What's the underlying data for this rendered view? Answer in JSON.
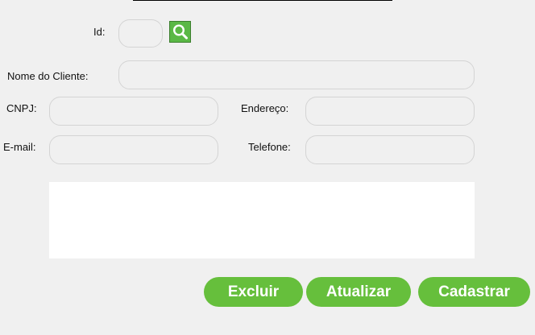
{
  "form": {
    "id_label": "Id:",
    "id_value": "",
    "nome_label": "Nome do Cliente:",
    "nome_value": "",
    "cnpj_label": "CNPJ:",
    "cnpj_value": "",
    "endereco_label": "Endereço:",
    "endereco_value": "",
    "email_label": "E-mail:",
    "email_value": "",
    "telefone_label": "Telefone:",
    "telefone_value": ""
  },
  "search": {
    "icon": "search-icon"
  },
  "buttons": {
    "excluir": "Excluir",
    "atualizar": "Atualizar",
    "cadastrar": "Cadastrar"
  },
  "colors": {
    "accent_green": "#66bf3c",
    "background": "#f0f0f0"
  }
}
